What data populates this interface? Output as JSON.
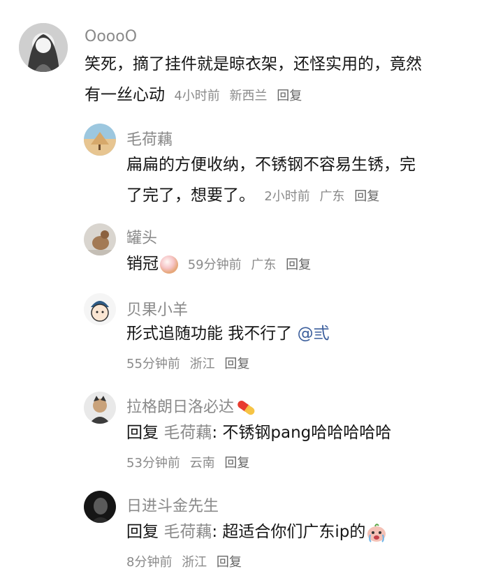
{
  "comments": [
    {
      "username": "OoooO",
      "content": "笑死，摘了挂件就是晾衣架，还怪实用的，竟然有一丝心动",
      "line1": "笑死，摘了挂件就是晾衣架，还怪实用的，竟然",
      "line2": "有一丝心动",
      "time": "4小时前",
      "location": "新西兰",
      "reply_label": "回复"
    },
    {
      "username": "毛荷藕",
      "line1": "扁扁的方便收纳，不锈钢不容易生锈，完",
      "line2": "了完了，想要了。",
      "time": "2小时前",
      "location": "广东",
      "reply_label": "回复"
    },
    {
      "username": "罐头",
      "content": "销冠",
      "emoji": "pearl-emoji",
      "time": "59分钟前",
      "location": "广东",
      "reply_label": "回复"
    },
    {
      "username": "贝果小羊",
      "content": "形式追随功能 我不行了 ",
      "mention": "@弎",
      "time": "55分钟前",
      "location": "浙江",
      "reply_label": "回复"
    },
    {
      "username": "拉格朗日洛必达",
      "username_emoji": "pill-emoji",
      "reply_prefix": "回复",
      "reply_to": "毛荷藕",
      "content": ": 不锈钢pang哈哈哈哈哈",
      "time": "53分钟前",
      "location": "云南",
      "reply_label": "回复"
    },
    {
      "username": "日进斗金先生",
      "reply_prefix": "回复",
      "reply_to": "毛荷藕",
      "content": ": 超适合你们广东ip的",
      "emoji": "crying-face-emoji",
      "time": "8分钟前",
      "location": "浙江",
      "reply_label": "回复"
    }
  ],
  "colors": {
    "username": "#8a8a8a",
    "mention": "#3b5e9c",
    "text": "#151515"
  }
}
